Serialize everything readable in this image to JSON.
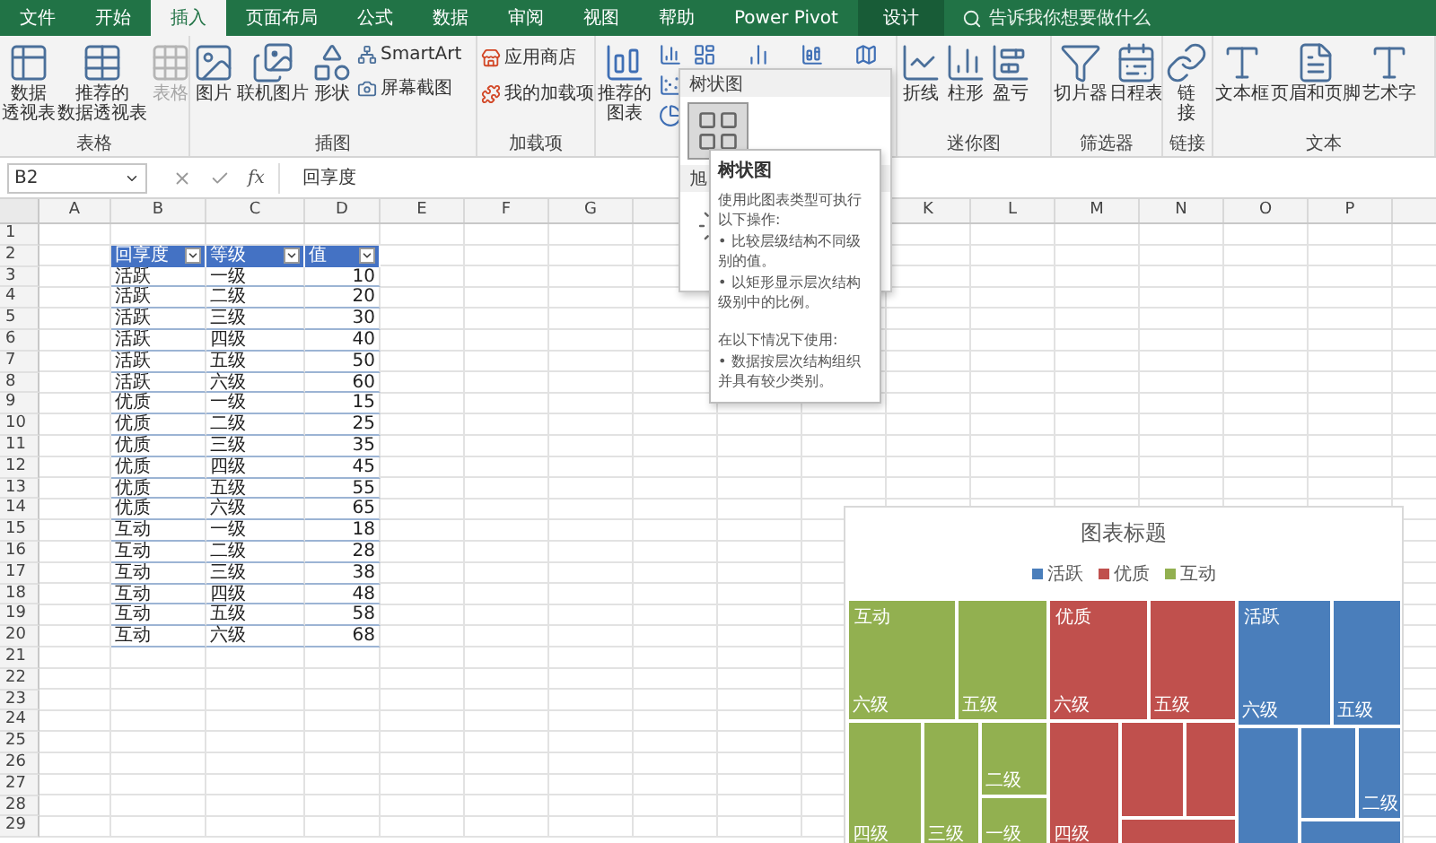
{
  "tabs": [
    {
      "label": "文件",
      "selected": false
    },
    {
      "label": "开始",
      "selected": false
    },
    {
      "label": "插入",
      "selected": true
    },
    {
      "label": "页面布局",
      "selected": false
    },
    {
      "label": "公式",
      "selected": false
    },
    {
      "label": "数据",
      "selected": false
    },
    {
      "label": "审阅",
      "selected": false
    },
    {
      "label": "视图",
      "selected": false
    },
    {
      "label": "帮助",
      "selected": false
    },
    {
      "label": "Power Pivot",
      "selected": false
    }
  ],
  "contextual_tab": {
    "label": "设计"
  },
  "search": {
    "placeholder": "告诉我你想要做什么"
  },
  "ribbon": [
    {
      "label": "表格",
      "items": [
        {
          "kind": "large",
          "lines": [
            "数据",
            "透视表"
          ],
          "disabled": false
        },
        {
          "kind": "large",
          "lines": [
            "推荐的",
            "数据透视表"
          ],
          "disabled": false
        },
        {
          "kind": "large",
          "lines": [
            "表格"
          ],
          "disabled": true
        }
      ]
    },
    {
      "label": "插图",
      "items": [
        {
          "kind": "large",
          "lines": [
            "图片"
          ],
          "disabled": false
        },
        {
          "kind": "large",
          "lines": [
            "联机图片"
          ],
          "disabled": false
        },
        {
          "kind": "large",
          "lines": [
            "形状"
          ],
          "disabled": false
        },
        {
          "kind": "small",
          "label": "SmartArt",
          "disabled": false
        },
        {
          "kind": "small",
          "label": "屏幕截图",
          "disabled": false
        }
      ]
    },
    {
      "label": "加载项",
      "items": [
        {
          "kind": "small",
          "label": "应用商店",
          "disabled": false
        },
        {
          "kind": "small",
          "label": "我的加载项",
          "disabled": false
        }
      ]
    },
    {
      "items": [
        {
          "kind": "large",
          "lines": [
            "推荐的",
            "图表"
          ],
          "disabled": false
        },
        {
          "kind": "icon",
          "disabled": false
        },
        {
          "kind": "icon",
          "disabled": false
        },
        {
          "kind": "icon",
          "disabled": false
        },
        {
          "kind": "topicon",
          "disabled": false
        },
        {
          "kind": "topicon",
          "disabled": false
        },
        {
          "kind": "topicon",
          "disabled": false
        },
        {
          "kind": "topicon",
          "disabled": false
        }
      ]
    },
    {
      "label": "迷你图",
      "items": [
        {
          "kind": "large",
          "lines": [
            "折线"
          ],
          "disabled": false
        },
        {
          "kind": "large",
          "lines": [
            "柱形"
          ],
          "disabled": false
        },
        {
          "kind": "large",
          "lines": [
            "盈亏"
          ],
          "disabled": false
        }
      ]
    },
    {
      "label": "筛选器",
      "items": [
        {
          "kind": "large",
          "lines": [
            "切片器"
          ],
          "disabled": false
        },
        {
          "kind": "large",
          "lines": [
            "日程表"
          ],
          "disabled": false
        }
      ]
    },
    {
      "label": "链接",
      "items": [
        {
          "kind": "large",
          "lines": [
            "链",
            "接"
          ],
          "disabled": false
        }
      ]
    },
    {
      "label": "文本",
      "items": [
        {
          "kind": "large",
          "lines": [
            "文本框"
          ],
          "disabled": false
        },
        {
          "kind": "large",
          "lines": [
            "页眉和页脚"
          ],
          "disabled": false
        },
        {
          "kind": "large",
          "lines": [
            "艺术字"
          ],
          "disabled": false
        }
      ]
    }
  ],
  "name_box": "B2",
  "function_label": "fx",
  "formula": "回享度",
  "columns_left": [
    "A",
    "B",
    "C",
    "D",
    "E",
    "F",
    "G"
  ],
  "columns_right": [
    "K",
    "L",
    "M",
    "N",
    "O",
    "P"
  ],
  "row_numbers": [
    "1",
    "2",
    "3",
    "4",
    "5",
    "6",
    "7",
    "8",
    "9",
    "10",
    "11",
    "12",
    "13",
    "14",
    "15",
    "16",
    "17",
    "18",
    "19",
    "20",
    "21",
    "22",
    "23",
    "24",
    "25",
    "26",
    "27",
    "28",
    "29"
  ],
  "table": {
    "columns": [
      "回享度",
      "等级",
      "值"
    ],
    "rows": [
      [
        "活跃",
        "一级",
        "10"
      ],
      [
        "活跃",
        "二级",
        "20"
      ],
      [
        "活跃",
        "三级",
        "30"
      ],
      [
        "活跃",
        "四级",
        "40"
      ],
      [
        "活跃",
        "五级",
        "50"
      ],
      [
        "活跃",
        "六级",
        "60"
      ],
      [
        "优质",
        "一级",
        "15"
      ],
      [
        "优质",
        "二级",
        "25"
      ],
      [
        "优质",
        "三级",
        "35"
      ],
      [
        "优质",
        "四级",
        "45"
      ],
      [
        "优质",
        "五级",
        "55"
      ],
      [
        "优质",
        "六级",
        "65"
      ],
      [
        "互动",
        "一级",
        "18"
      ],
      [
        "互动",
        "二级",
        "28"
      ],
      [
        "互动",
        "三级",
        "38"
      ],
      [
        "互动",
        "四级",
        "48"
      ],
      [
        "互动",
        "五级",
        "58"
      ],
      [
        "互动",
        "六级",
        "68"
      ]
    ]
  },
  "chart": {
    "title": "图表标题",
    "legend": [
      {
        "label": "活跃",
        "color": "#4a7ebb"
      },
      {
        "label": "优质",
        "color": "#c0504d"
      },
      {
        "label": "互动",
        "color": "#92b050"
      }
    ],
    "groups": [
      {
        "name": "互动",
        "color": "#92b050",
        "tiles": [
          "六级",
          "五级",
          "四级",
          "三级",
          "二级",
          "一级"
        ]
      },
      {
        "name": "优质",
        "color": "#c0504d",
        "tiles": [
          "六级",
          "五级",
          "四级"
        ]
      },
      {
        "name": "活跃",
        "color": "#4a7ebb",
        "tiles": [
          "六级",
          "五级",
          "二级"
        ]
      }
    ]
  },
  "dropdown": {
    "sections": [
      {
        "title": "树状图"
      },
      {
        "title": "旭"
      }
    ]
  },
  "tooltip": {
    "title": "树状图",
    "lines": [
      "使用此图表类型可执行以下操作:",
      "• 比较层级结构不同级别的值。",
      "• 以矩形显示层次结构级别中的比例。",
      "在以下情况下使用:",
      "• 数据按层次结构组织并具有较少类别。"
    ]
  }
}
